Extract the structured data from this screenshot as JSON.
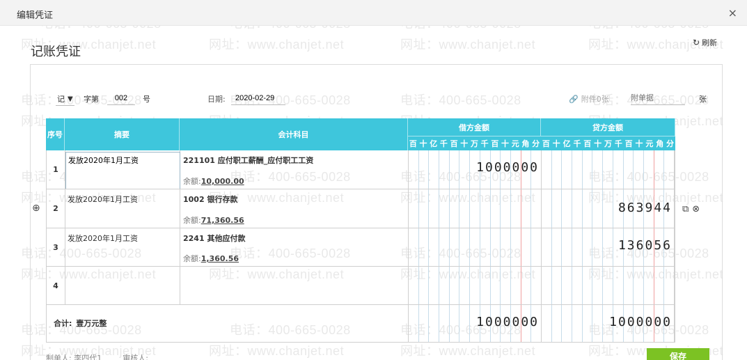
{
  "dialog": {
    "title": "编辑凭证",
    "close_label": "×"
  },
  "voucher": {
    "heading": "记账凭证",
    "refresh_label": "刷新",
    "refresh_icon": "↻"
  },
  "watermark": {
    "phone": "电话：400-665-0028",
    "site": "网址：www.chanjet.net"
  },
  "topbar": {
    "word": "记",
    "zi_label": "字第",
    "number": "002",
    "hao_label": "号",
    "date_label": "日期:",
    "date": "2020-02-29",
    "attach_label": "附件0张",
    "attach_input_placeholder": "附单据",
    "zhang_label": "张"
  },
  "table": {
    "headers": {
      "no": "序号",
      "summary": "摘要",
      "account": "会计科目",
      "debit": "借方金额",
      "credit": "贷方金额"
    },
    "units": [
      "百",
      "十",
      "亿",
      "千",
      "百",
      "十",
      "万",
      "千",
      "百",
      "十",
      "元",
      "角",
      "分"
    ],
    "balance_label": "余额:",
    "rows": [
      {
        "no": "1",
        "summary": "发放2020年1月工资",
        "account": "221101 应付职工薪酬_应付职工工资",
        "balance": "10,000.00",
        "debit": "1000000",
        "credit": ""
      },
      {
        "no": "2",
        "summary": "发放2020年1月工资",
        "account": "1002 银行存款",
        "balance": "71,360.56",
        "debit": "",
        "credit": "863944"
      },
      {
        "no": "3",
        "summary": "发放2020年1月工资",
        "account": "2241 其他应付款",
        "balance": "1,360.56",
        "debit": "",
        "credit": "136056"
      },
      {
        "no": "4",
        "summary": "",
        "account": "",
        "balance": "",
        "debit": "",
        "credit": ""
      }
    ],
    "total": {
      "label": "合计:",
      "caption": "壹万元整",
      "debit": "1000000",
      "credit": "1000000"
    }
  },
  "row_actions": {
    "add_icon": "⊕",
    "copy_icon": "⧉",
    "delete_icon": "⊗"
  },
  "footer": {
    "preparer_label": "制单人:",
    "preparer": "李四代1",
    "reviewer_label": "审核人:"
  },
  "buttons": {
    "save": "保存"
  }
}
